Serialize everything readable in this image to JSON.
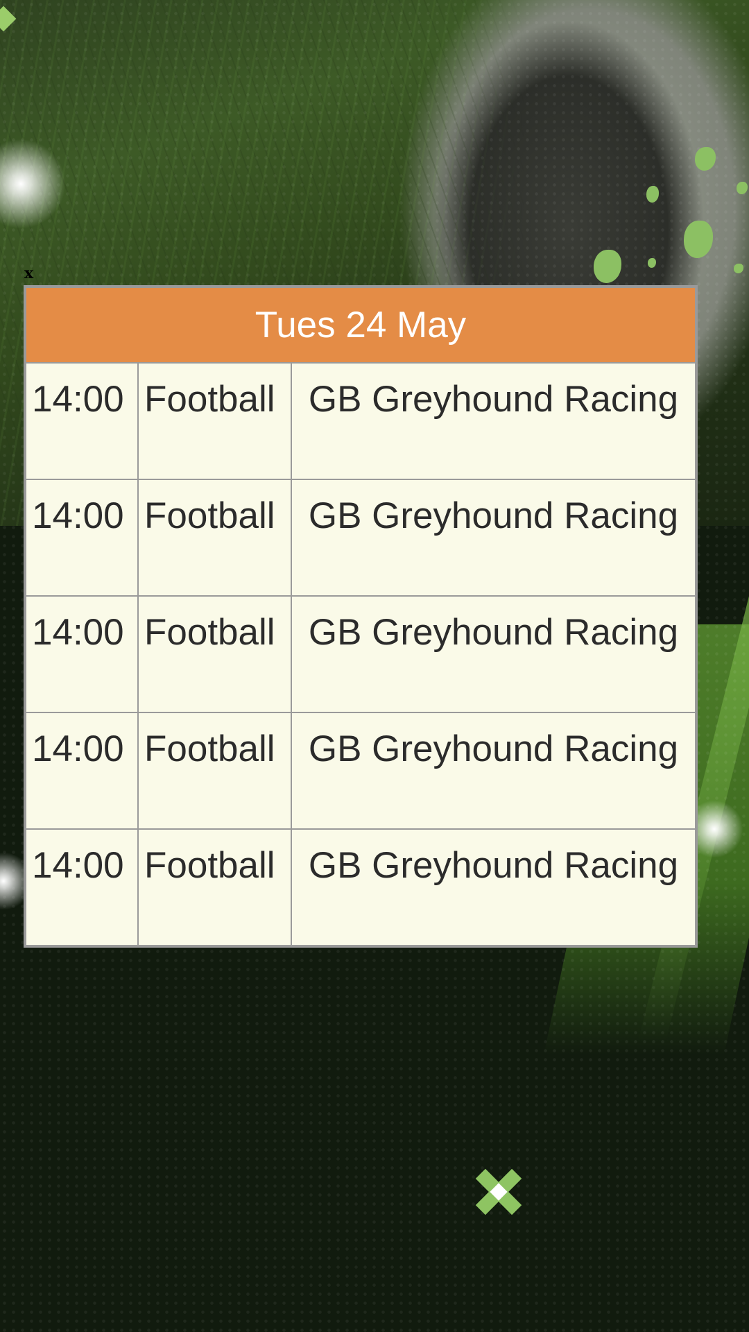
{
  "page": {
    "background_color": "#111b0e",
    "accent_color": "#e48c46",
    "table_background": "#fafae8",
    "close_color": "#8ec462"
  },
  "dismiss": {
    "small_label": "x",
    "icon": "close-x-icon"
  },
  "schedule": {
    "date_header": "Tues 24 May",
    "rows": [
      {
        "time": "14:00",
        "sport": "Football",
        "event": "GB Greyhound Racing"
      },
      {
        "time": "14:00",
        "sport": "Football",
        "event": "GB Greyhound Racing"
      },
      {
        "time": "14:00",
        "sport": "Football",
        "event": "GB Greyhound Racing"
      },
      {
        "time": "14:00",
        "sport": "Football",
        "event": "GB Greyhound Racing"
      },
      {
        "time": "14:00",
        "sport": "Football",
        "event": "GB Greyhound Racing"
      }
    ]
  }
}
